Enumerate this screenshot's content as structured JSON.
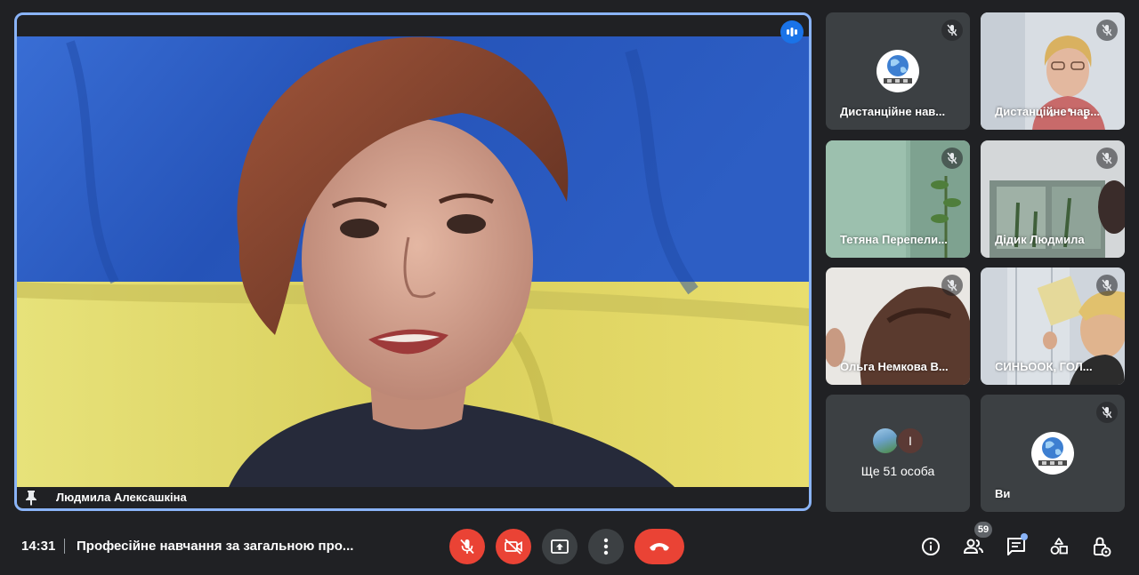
{
  "main_speaker": {
    "name": "Людмила Алексашкіна"
  },
  "tiles": [
    {
      "name": "Дистанційне нав...",
      "kind": "avatar-globe",
      "muted": true
    },
    {
      "name": "Дистанційне нав...",
      "kind": "video",
      "muted": true
    },
    {
      "name": "Тетяна Перепели...",
      "kind": "video",
      "muted": true
    },
    {
      "name": "Дідик Людмила",
      "kind": "video",
      "muted": true
    },
    {
      "name": "Ольга Немкова В...",
      "kind": "video",
      "muted": true
    },
    {
      "name": "СИНЬООК, ГОЛ...",
      "kind": "video",
      "muted": true
    }
  ],
  "more_tile": {
    "label": "Ще 51 особа",
    "avatar_letter": "І"
  },
  "self_tile": {
    "name": "Ви",
    "muted": true
  },
  "bottom_bar": {
    "time": "14:31",
    "meeting_title": "Професійне навчання за загальною про...",
    "participants_count": "59",
    "controls": [
      "mic-off-icon",
      "camera-off-icon",
      "present-icon",
      "more-options-icon",
      "hang-up-icon"
    ],
    "right_icons": [
      "info-icon",
      "people-icon",
      "chat-icon",
      "activities-icon",
      "host-controls-icon"
    ]
  },
  "colors": {
    "background": "#202124",
    "active_border": "#8ab4f8",
    "danger": "#ea4335",
    "button_grey": "#3c4043",
    "speaking_badge": "#1a73e8",
    "flag_blue": "#2f62cc",
    "flag_yellow": "#e3d868"
  }
}
